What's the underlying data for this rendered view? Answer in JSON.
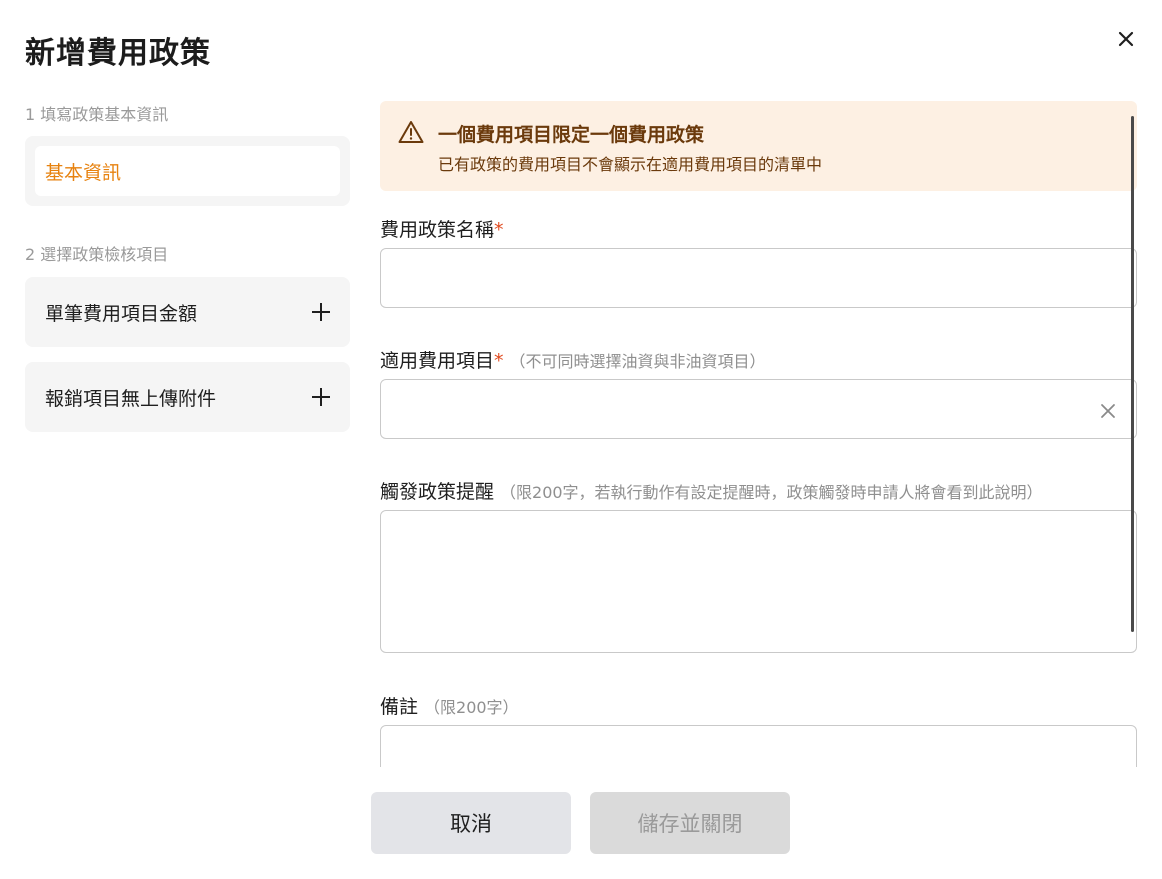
{
  "dialog": {
    "title": "新增費用政策"
  },
  "steps": {
    "step1_label": "1 填寫政策基本資訊",
    "step1_item": "基本資訊",
    "step2_label": "2 選擇政策檢核項目",
    "check_items": [
      {
        "label": "單筆費用項目金額"
      },
      {
        "label": "報銷項目無上傳附件"
      }
    ]
  },
  "notice": {
    "title": "一個費用項目限定一個費用政策",
    "subtitle": "已有政策的費用項目不會顯示在適用費用項目的清單中",
    "icon": "warning-icon",
    "accent": "#6b3a0c",
    "background": "#fdf0e3"
  },
  "form": {
    "policy_name": {
      "label": "費用政策名稱",
      "required_mark": "*",
      "value": ""
    },
    "applicable_items": {
      "label": "適用費用項目",
      "required_mark": "*",
      "hint": "（不可同時選擇油資與非油資項目）",
      "value": ""
    },
    "trigger_reminder": {
      "label": "觸發政策提醒",
      "hint": "（限200字，若執行動作有設定提醒時，政策觸發時申請人將會看到此說明）",
      "value": ""
    },
    "note": {
      "label": "備註",
      "hint": "（限200字）",
      "value": ""
    }
  },
  "footer": {
    "cancel_label": "取消",
    "save_label": "儲存並關閉"
  },
  "colors": {
    "accent_orange": "#e7820f",
    "required_red": "#e04a1f",
    "panel_gray": "#f5f5f5"
  }
}
